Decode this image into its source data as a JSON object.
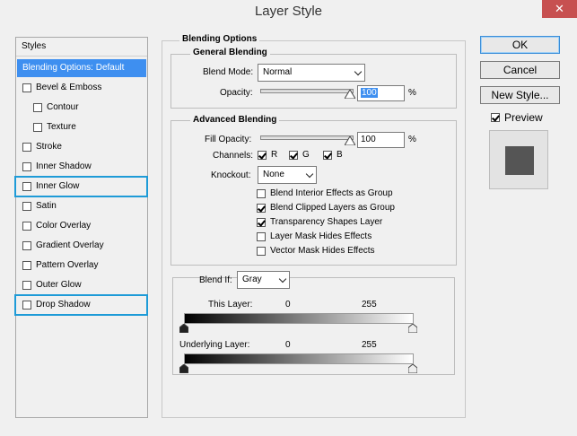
{
  "window": {
    "title": "Layer Style",
    "close_glyph": "✕"
  },
  "styles_panel": {
    "header": "Styles",
    "items": [
      {
        "label": "Blending Options: Default",
        "checkbox": false,
        "checked": false,
        "selected": true
      },
      {
        "label": "Bevel & Emboss",
        "checkbox": true,
        "checked": false
      },
      {
        "label": "Contour",
        "checkbox": true,
        "checked": false,
        "indent": true
      },
      {
        "label": "Texture",
        "checkbox": true,
        "checked": false,
        "indent": true
      },
      {
        "label": "Stroke",
        "checkbox": true,
        "checked": false
      },
      {
        "label": "Inner Shadow",
        "checkbox": true,
        "checked": false
      },
      {
        "label": "Inner Glow",
        "checkbox": true,
        "checked": false,
        "highlighted": true
      },
      {
        "label": "Satin",
        "checkbox": true,
        "checked": false
      },
      {
        "label": "Color Overlay",
        "checkbox": true,
        "checked": false
      },
      {
        "label": "Gradient Overlay",
        "checkbox": true,
        "checked": false
      },
      {
        "label": "Pattern Overlay",
        "checkbox": true,
        "checked": false
      },
      {
        "label": "Outer Glow",
        "checkbox": true,
        "checked": false
      },
      {
        "label": "Drop Shadow",
        "checkbox": true,
        "checked": false,
        "highlighted": true
      }
    ]
  },
  "blending_options": {
    "title": "Blending Options",
    "general": {
      "title": "General Blending",
      "blend_mode_label": "Blend Mode:",
      "blend_mode_value": "Normal",
      "opacity_label": "Opacity:",
      "opacity_value": "100",
      "opacity_unit": "%",
      "opacity_level": 1.0
    },
    "advanced": {
      "title": "Advanced Blending",
      "fill_opacity_label": "Fill Opacity:",
      "fill_opacity_value": "100",
      "fill_opacity_unit": "%",
      "fill_opacity_level": 1.0,
      "channels_label": "Channels:",
      "channels": [
        {
          "label": "R",
          "checked": true
        },
        {
          "label": "G",
          "checked": true
        },
        {
          "label": "B",
          "checked": true
        }
      ],
      "knockout_label": "Knockout:",
      "knockout_value": "None",
      "options": [
        {
          "label": "Blend Interior Effects as Group",
          "checked": false
        },
        {
          "label": "Blend Clipped Layers as Group",
          "checked": true
        },
        {
          "label": "Transparency Shapes Layer",
          "checked": true
        },
        {
          "label": "Layer Mask Hides Effects",
          "checked": false
        },
        {
          "label": "Vector Mask Hides Effects",
          "checked": false
        }
      ]
    },
    "blend_if": {
      "label": "Blend If:",
      "value": "Gray",
      "this_layer_label": "This Layer:",
      "this_layer_min": "0",
      "this_layer_max": "255",
      "underlying_label": "Underlying Layer:",
      "underlying_min": "0",
      "underlying_max": "255"
    }
  },
  "buttons": {
    "ok": "OK",
    "cancel": "Cancel",
    "new_style": "New Style...",
    "preview_label": "Preview",
    "preview_checked": true
  },
  "colors": {
    "accent": "#3e8ff0",
    "highlight_border": "#1e9bd7",
    "close_bg": "#c75050",
    "preview_swatch": "#555555"
  }
}
